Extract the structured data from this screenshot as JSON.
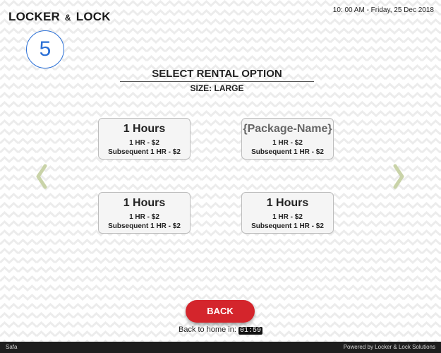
{
  "header": {
    "logo_left": "LOCKER",
    "logo_amp": "&",
    "logo_right": "LOCK",
    "datetime": "10: 00 AM - Friday, 25 Dec 2018"
  },
  "step": {
    "number": "5"
  },
  "heading": {
    "title": "SELECT RENTAL OPTION",
    "size_label": "SIZE: LARGE"
  },
  "options": [
    {
      "name": "1 Hours",
      "rate": "1 HR - $2",
      "subsequent": "Subsequent 1 HR - $2"
    },
    {
      "name": "{Package-Name}",
      "rate": "1 HR - $2",
      "subsequent": "Subsequent 1 HR - $2"
    },
    {
      "name": "1 Hours",
      "rate": "1 HR - $2",
      "subsequent": "Subsequent 1 HR - $2"
    },
    {
      "name": "1 Hours",
      "rate": "1 HR - $2",
      "subsequent": "Subsequent 1 HR - $2"
    }
  ],
  "navigation": {
    "prev_icon": "chevron-left-icon",
    "next_icon": "chevron-right-icon"
  },
  "actions": {
    "back_label": "BACK",
    "home_text": "Back to home in:",
    "countdown": "01:59"
  },
  "footer": {
    "left": "Safa",
    "right": "Powered by Locker & Lock Solutions"
  },
  "colors": {
    "accent_blue": "#2a6fd6",
    "back_red": "#d4252c",
    "arrow_green": "#c9d3a8",
    "footer_bg": "#1e1e1e"
  }
}
